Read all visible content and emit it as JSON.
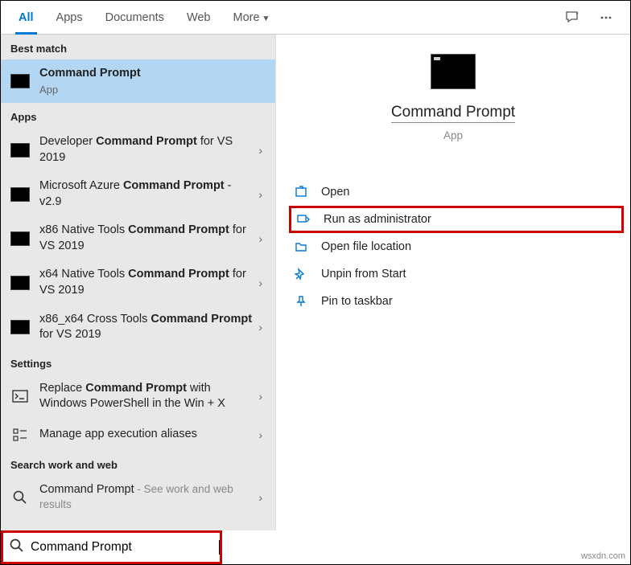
{
  "tabs": {
    "all": "All",
    "apps": "Apps",
    "documents": "Documents",
    "web": "Web",
    "more": "More"
  },
  "sections": {
    "best_match": "Best match",
    "apps": "Apps",
    "settings": "Settings",
    "search_work_web": "Search work and web"
  },
  "best_match": {
    "title": "Command Prompt",
    "subtitle": "App"
  },
  "apps_list": [
    {
      "pre": "Developer ",
      "bold": "Command Prompt",
      "post": " for VS 2019"
    },
    {
      "pre": "Microsoft Azure ",
      "bold": "Command Prompt",
      "post": " - v2.9"
    },
    {
      "pre": "x86 Native Tools ",
      "bold": "Command Prompt",
      "post": " for VS 2019"
    },
    {
      "pre": "x64 Native Tools ",
      "bold": "Command Prompt",
      "post": " for VS 2019"
    },
    {
      "pre": "x86_x64 Cross Tools ",
      "bold": "Command Prompt",
      "post": " for VS 2019"
    }
  ],
  "settings_list": [
    {
      "pre": "Replace ",
      "bold": "Command Prompt",
      "post": " with Windows PowerShell in the Win + X"
    },
    {
      "pre": "Manage app execution aliases",
      "bold": "",
      "post": ""
    }
  ],
  "web_list": {
    "title": "Command Prompt",
    "note": " - See work and web results"
  },
  "preview": {
    "title": "Command Prompt",
    "subtitle": "App"
  },
  "actions": {
    "open": "Open",
    "run_admin": "Run as administrator",
    "open_location": "Open file location",
    "unpin_start": "Unpin from Start",
    "pin_taskbar": "Pin to taskbar"
  },
  "search_value": "Command Prompt",
  "watermark": "wsxdn.com"
}
